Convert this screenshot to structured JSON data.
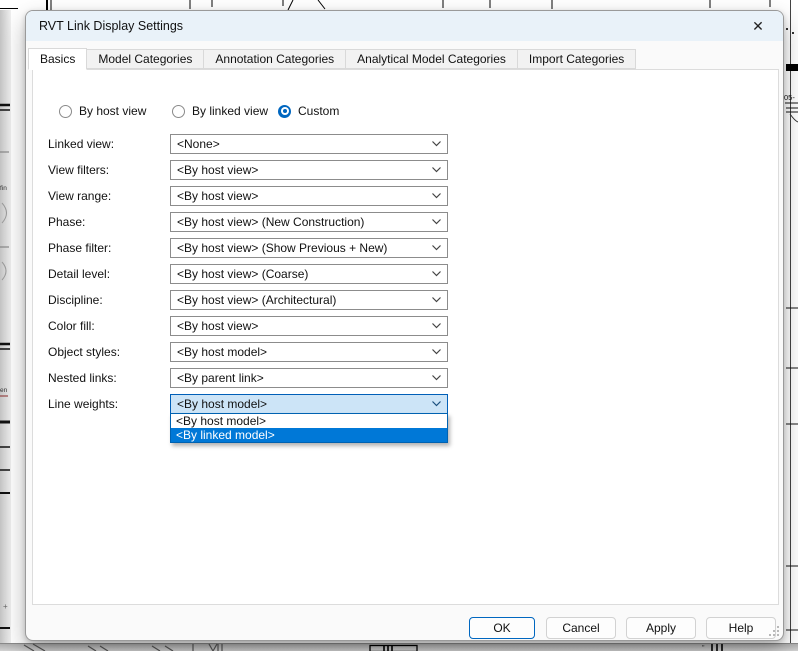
{
  "window": {
    "title": "RVT Link Display Settings",
    "close_icon": "✕"
  },
  "tabs": [
    {
      "label": "Basics",
      "active": true
    },
    {
      "label": "Model Categories",
      "active": false
    },
    {
      "label": "Annotation Categories",
      "active": false
    },
    {
      "label": "Analytical Model Categories",
      "active": false
    },
    {
      "label": "Import Categories",
      "active": false
    }
  ],
  "radio_group": [
    {
      "label": "By host view",
      "selected": false
    },
    {
      "label": "By linked view",
      "selected": false
    },
    {
      "label": "Custom",
      "selected": true
    }
  ],
  "fields": [
    {
      "label": "Linked view:",
      "value": "<None>"
    },
    {
      "label": "View filters:",
      "value": "<By host view>"
    },
    {
      "label": "View range:",
      "value": "<By host view>"
    },
    {
      "label": "Phase:",
      "value": "<By host view> (New Construction)"
    },
    {
      "label": "Phase filter:",
      "value": "<By host view> (Show Previous + New)"
    },
    {
      "label": "Detail level:",
      "value": "<By host view> (Coarse)"
    },
    {
      "label": "Discipline:",
      "value": "<By host view> (Architectural)"
    },
    {
      "label": "Color fill:",
      "value": "<By host view>"
    },
    {
      "label": "Object styles:",
      "value": "<By host model>"
    },
    {
      "label": "Nested links:",
      "value": "<By parent link>"
    },
    {
      "label": "Line weights:",
      "value": "<By host model>",
      "state": "open-focused"
    }
  ],
  "line_weights_dropdown": {
    "options": [
      {
        "label": "<By host model>",
        "highlighted": false
      },
      {
        "label": "<By linked model>",
        "highlighted": true
      }
    ]
  },
  "buttons": [
    {
      "label": "OK",
      "default": true
    },
    {
      "label": "Cancel",
      "default": false
    },
    {
      "label": "Apply",
      "default": false
    },
    {
      "label": "Help",
      "default": false
    }
  ],
  "colors": {
    "accent": "#0067c0",
    "selection_blue": "#0078d7",
    "combo_focus_bg": "#cce4f7",
    "titlebar_bg": "#e9f2f9"
  },
  "background_text_fragments": {
    "left_a": "fin",
    "left_b": "en",
    "right_a": "05-"
  }
}
